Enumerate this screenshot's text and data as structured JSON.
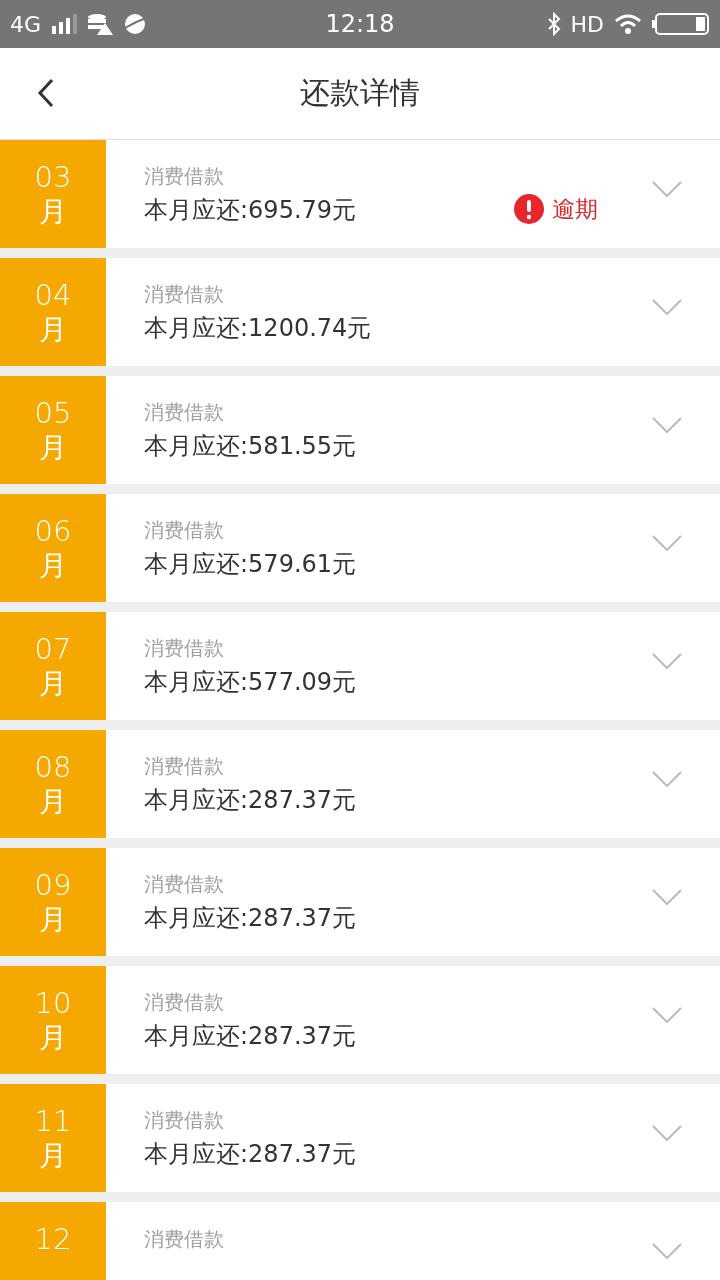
{
  "status_bar": {
    "network": "4G",
    "time": "12:18",
    "hd": "HD"
  },
  "header": {
    "title": "还款详情"
  },
  "rows": [
    {
      "month": "03",
      "unit": "月",
      "category": "消费借款",
      "amount": "本月应还:695.79元",
      "overdue": true,
      "overdue_label": "逾期"
    },
    {
      "month": "04",
      "unit": "月",
      "category": "消费借款",
      "amount": "本月应还:1200.74元",
      "overdue": false
    },
    {
      "month": "05",
      "unit": "月",
      "category": "消费借款",
      "amount": "本月应还:581.55元",
      "overdue": false
    },
    {
      "month": "06",
      "unit": "月",
      "category": "消费借款",
      "amount": "本月应还:579.61元",
      "overdue": false
    },
    {
      "month": "07",
      "unit": "月",
      "category": "消费借款",
      "amount": "本月应还:577.09元",
      "overdue": false
    },
    {
      "month": "08",
      "unit": "月",
      "category": "消费借款",
      "amount": "本月应还:287.37元",
      "overdue": false
    },
    {
      "month": "09",
      "unit": "月",
      "category": "消费借款",
      "amount": "本月应还:287.37元",
      "overdue": false
    },
    {
      "month": "10",
      "unit": "月",
      "category": "消费借款",
      "amount": "本月应还:287.37元",
      "overdue": false
    },
    {
      "month": "11",
      "unit": "月",
      "category": "消费借款",
      "amount": "本月应还:287.37元",
      "overdue": false
    },
    {
      "month": "12",
      "category": "消费借款",
      "overdue": false
    }
  ]
}
